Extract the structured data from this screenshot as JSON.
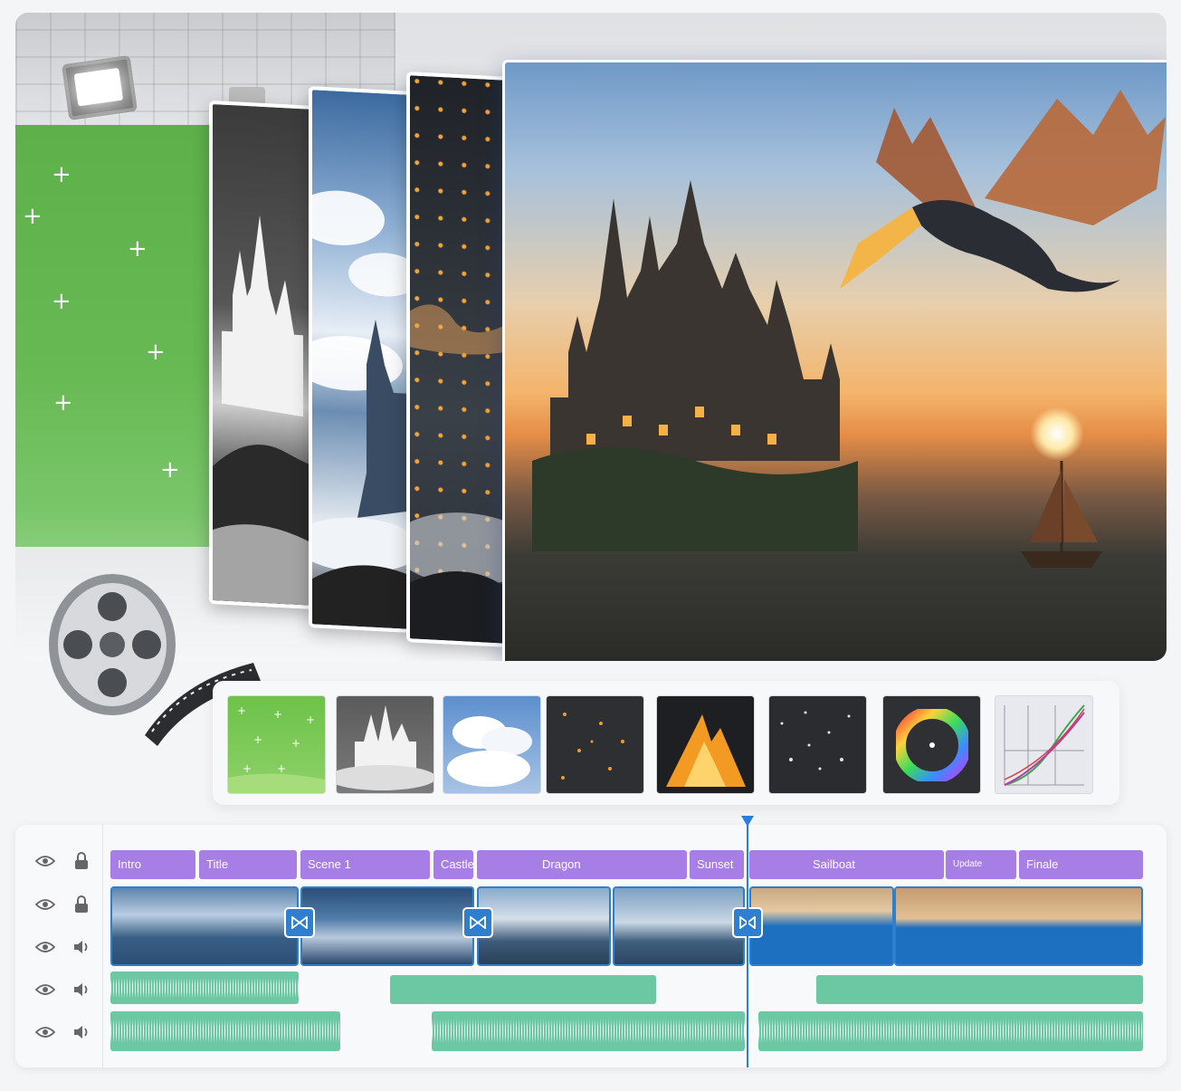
{
  "fx_strip": {
    "items": [
      "green-screen",
      "castle-mask",
      "clouds",
      "embers",
      "fire",
      "particles",
      "color-wheel",
      "curves"
    ]
  },
  "timeline": {
    "tracks": [
      {
        "visibility_icon": "eye-icon",
        "type_icon": "lock-icon"
      },
      {
        "visibility_icon": "eye-icon",
        "type_icon": "lock-icon"
      },
      {
        "visibility_icon": "eye-icon",
        "type_icon": "speaker-icon"
      },
      {
        "visibility_icon": "eye-icon",
        "type_icon": "speaker-icon"
      },
      {
        "visibility_icon": "eye-icon",
        "type_icon": "speaker-icon"
      }
    ],
    "labels": [
      {
        "text": "Intro"
      },
      {
        "text": "Title"
      },
      {
        "text": "Scene 1"
      },
      {
        "text": "Castle"
      },
      {
        "text": "Dragon"
      },
      {
        "text": "Sunset"
      },
      {
        "text": "Sailboat"
      },
      {
        "text": "Update"
      },
      {
        "text": "Finale"
      }
    ],
    "accent": "#2a7de1",
    "label_color": "#a77de6",
    "audio_color": "#6cc7a3"
  }
}
